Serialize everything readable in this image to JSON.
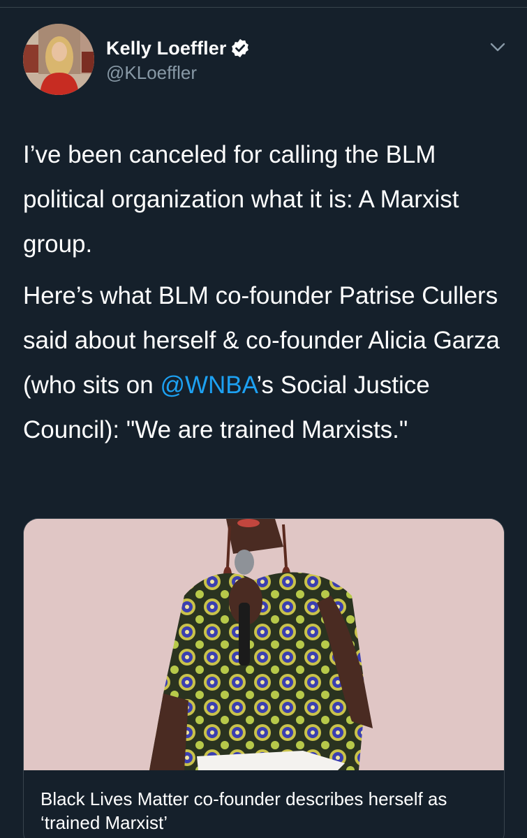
{
  "tweet": {
    "author": {
      "display_name": "Kelly Loeffler",
      "handle": "@KLoeffler",
      "verified": true
    },
    "text": {
      "paragraph1": "I’ve been canceled for calling the BLM political organization what it is: A Marxist group.",
      "paragraph2_before": "Here’s what BLM co-founder Patrise Cullers said about herself & co-founder Alicia Garza (who sits on ",
      "mention": "@WNBA",
      "paragraph2_after": "’s Social Justice Council): \"We are trained Marxists.\""
    },
    "card": {
      "title": "Black Lives Matter co-founder describes herself as ‘trained Marxist’"
    }
  },
  "colors": {
    "background": "#15202b",
    "text": "#ffffff",
    "secondary_text": "#8899a6",
    "link": "#1da1f2",
    "verified_badge": "#ffffff"
  },
  "icons": {
    "verified": "verified-badge-icon",
    "menu": "chevron-down-icon"
  }
}
